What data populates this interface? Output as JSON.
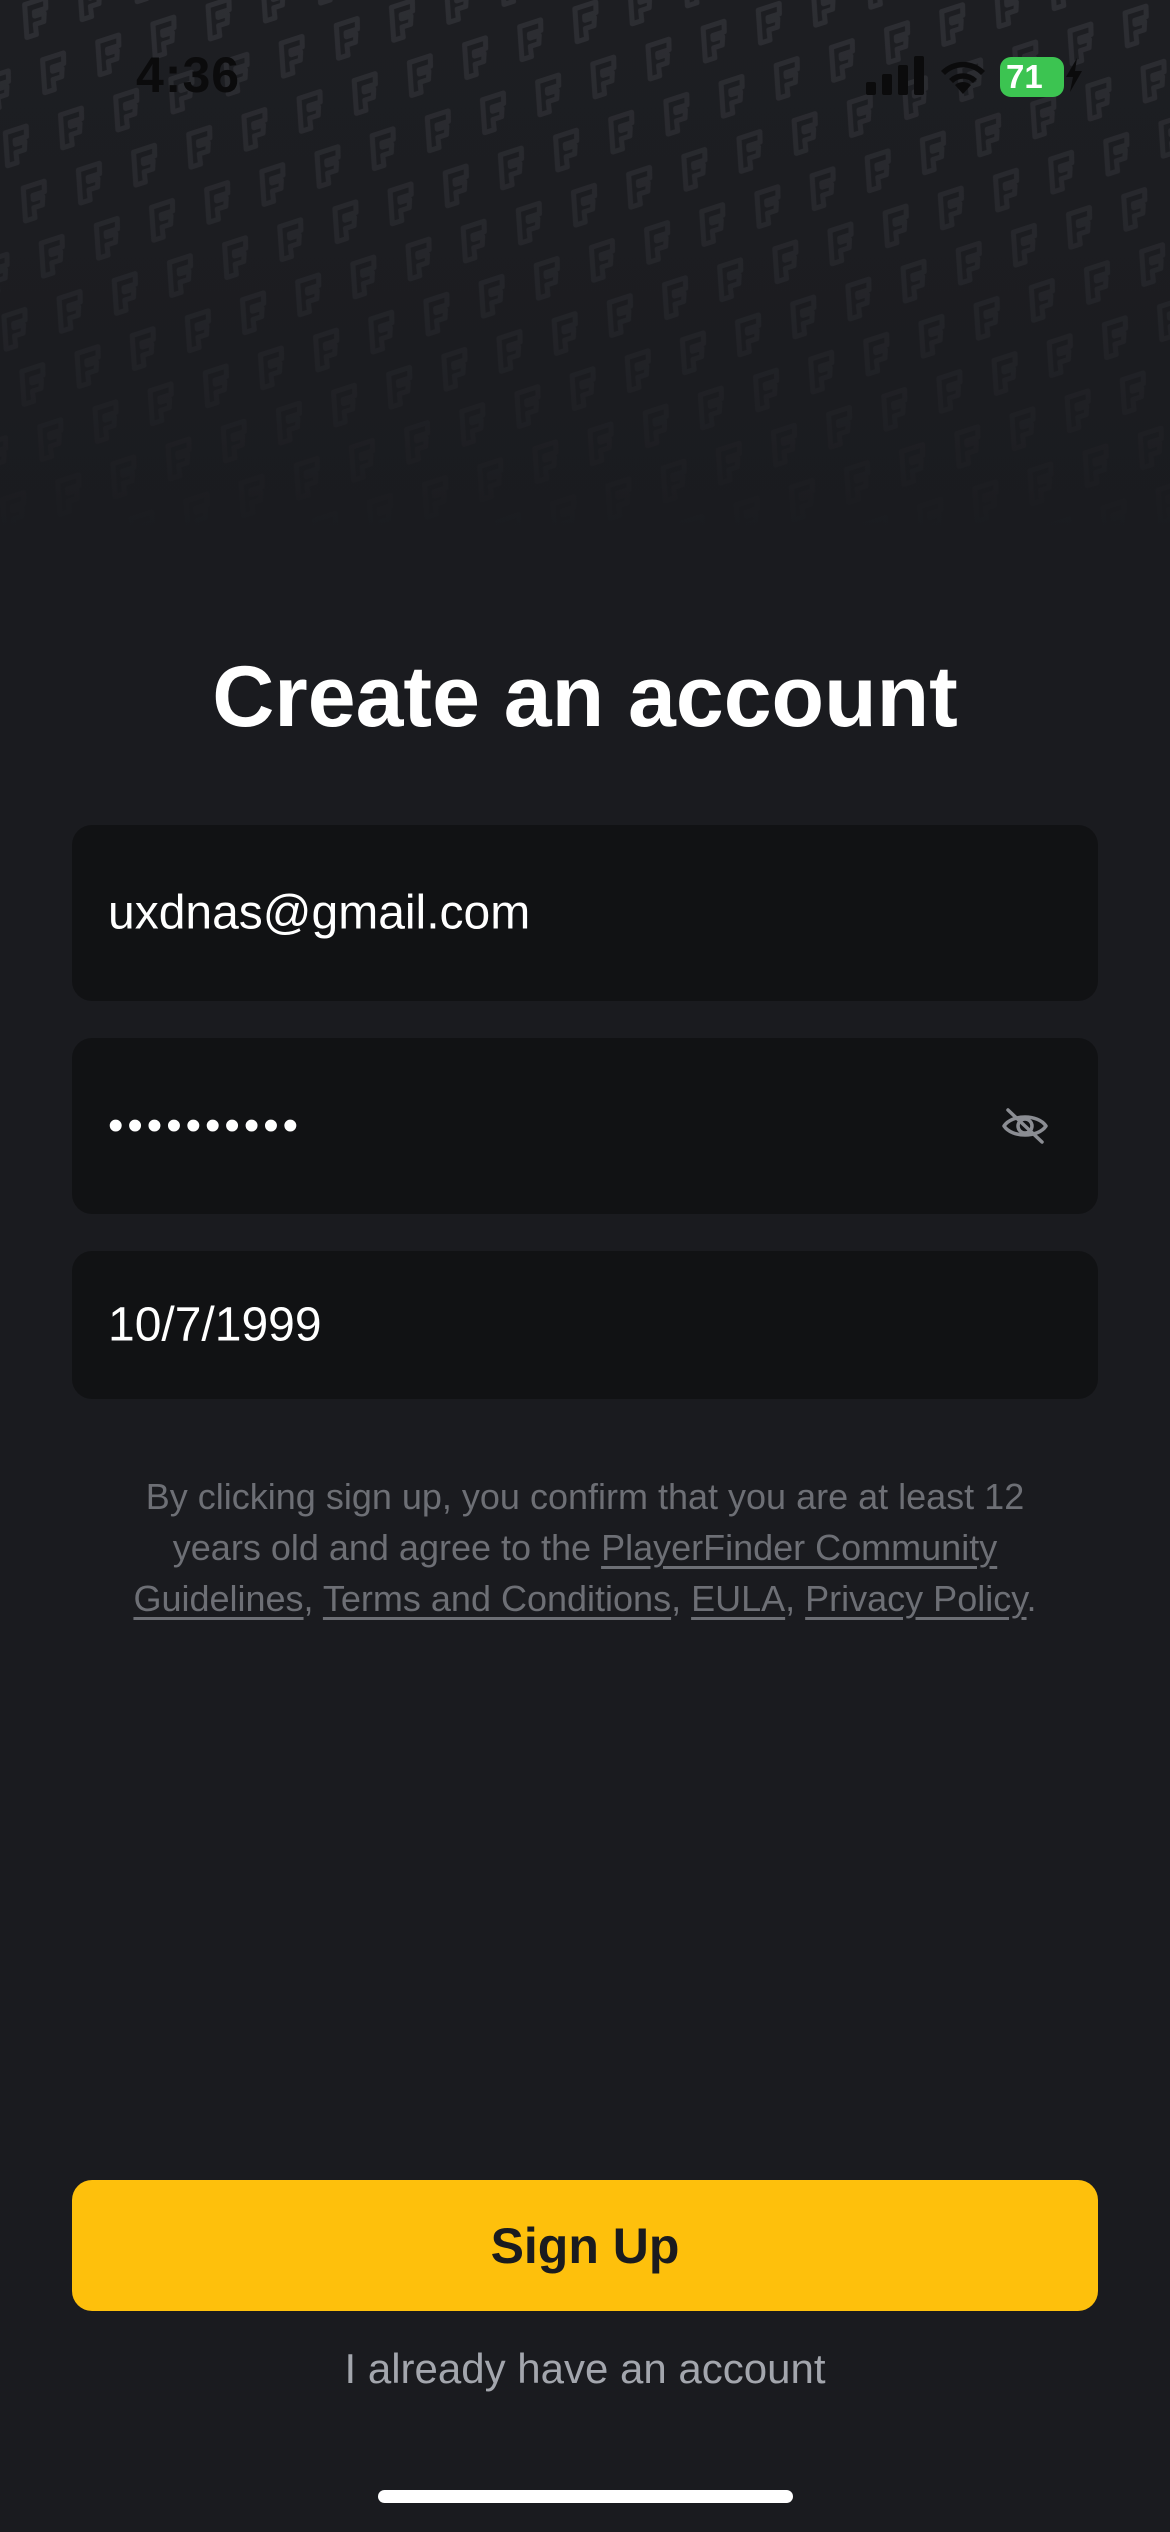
{
  "status_bar": {
    "time": "4:36",
    "battery_level": "71",
    "battery_color": "#3cc451"
  },
  "header": {
    "title": "Create an account"
  },
  "form": {
    "email_value": "uxdnas@gmail.com",
    "password_value": "••••••••••",
    "password_toggle_icon": "eye-slash-icon",
    "dob_value": "10/7/1999"
  },
  "legal": {
    "intro": "By clicking sign up, you confirm that you are at least 12 years old and agree to the ",
    "community_link": "PlayerFinder Community Guidelines",
    "sep1": ", ",
    "terms_link": "Terms and Conditions",
    "sep2": ", ",
    "eula_link": "EULA",
    "sep3": ", ",
    "privacy_link": "Privacy Policy",
    "end": "."
  },
  "actions": {
    "signup_label": "Sign Up",
    "login_label": "I already have an account",
    "accent_color": "#fec00c"
  }
}
